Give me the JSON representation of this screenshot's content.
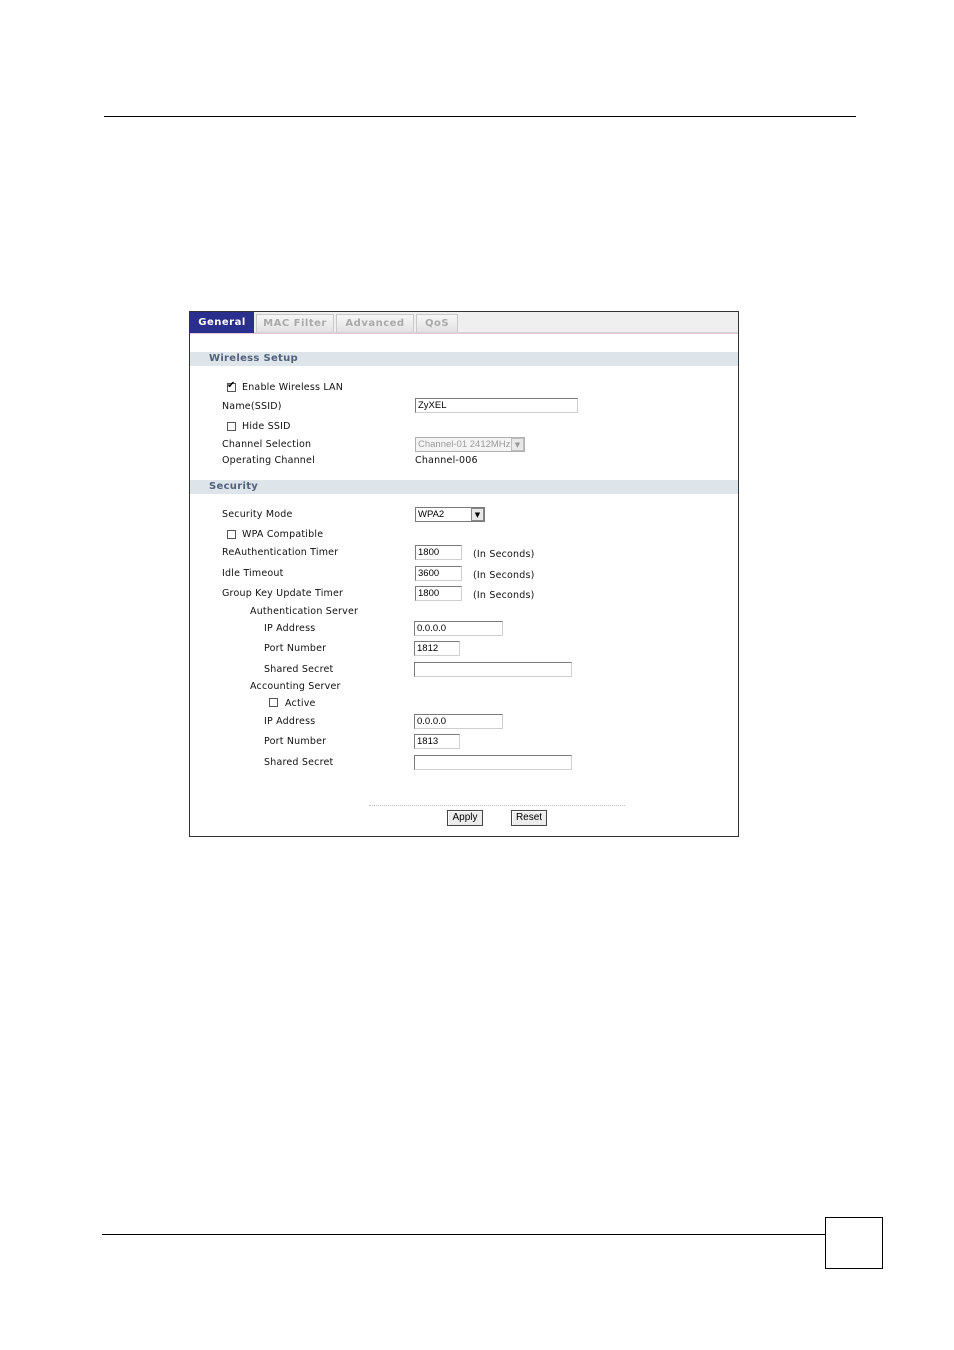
{
  "tabs": [
    {
      "label": "General",
      "active": true
    },
    {
      "label": "MAC Filter",
      "active": false
    },
    {
      "label": "Advanced",
      "active": false
    },
    {
      "label": "QoS",
      "active": false
    }
  ],
  "wireless_setup": {
    "title": "Wireless Setup",
    "enable_wireless_label": "Enable Wireless LAN",
    "enable_wireless_checked": true,
    "ssid_label": "Name(SSID)",
    "ssid_value": "ZyXEL",
    "hide_ssid_label": "Hide SSID",
    "hide_ssid_checked": false,
    "channel_selection_label": "Channel Selection",
    "channel_selection_value": "Channel-01 2412MHz",
    "operating_channel_label": "Operating Channel",
    "operating_channel_value": "Channel-006"
  },
  "security": {
    "title": "Security",
    "mode_label": "Security Mode",
    "mode_value": "WPA2",
    "wpa_compatible_label": "WPA Compatible",
    "wpa_compatible_checked": false,
    "reauth_label": "ReAuthentication Timer",
    "reauth_value": "1800",
    "idle_label": "Idle Timeout",
    "idle_value": "3600",
    "group_key_label": "Group Key Update Timer",
    "group_key_value": "1800",
    "unit_label": "(In Seconds)",
    "auth_server": {
      "title": "Authentication Server",
      "ip_label": "IP Address",
      "ip_value": "0.0.0.0",
      "port_label": "Port Number",
      "port_value": "1812",
      "secret_label": "Shared Secret",
      "secret_value": ""
    },
    "acct_server": {
      "title": "Accounting Server",
      "active_label": "Active",
      "active_checked": false,
      "ip_label": "IP Address",
      "ip_value": "0.0.0.0",
      "port_label": "Port Number",
      "port_value": "1813",
      "secret_label": "Shared Secret",
      "secret_value": ""
    }
  },
  "buttons": {
    "apply": "Apply",
    "reset": "Reset"
  },
  "colors": {
    "active_tab": "#2a2f8e",
    "section_bar": "#dde4ea",
    "section_text": "#52617a"
  }
}
